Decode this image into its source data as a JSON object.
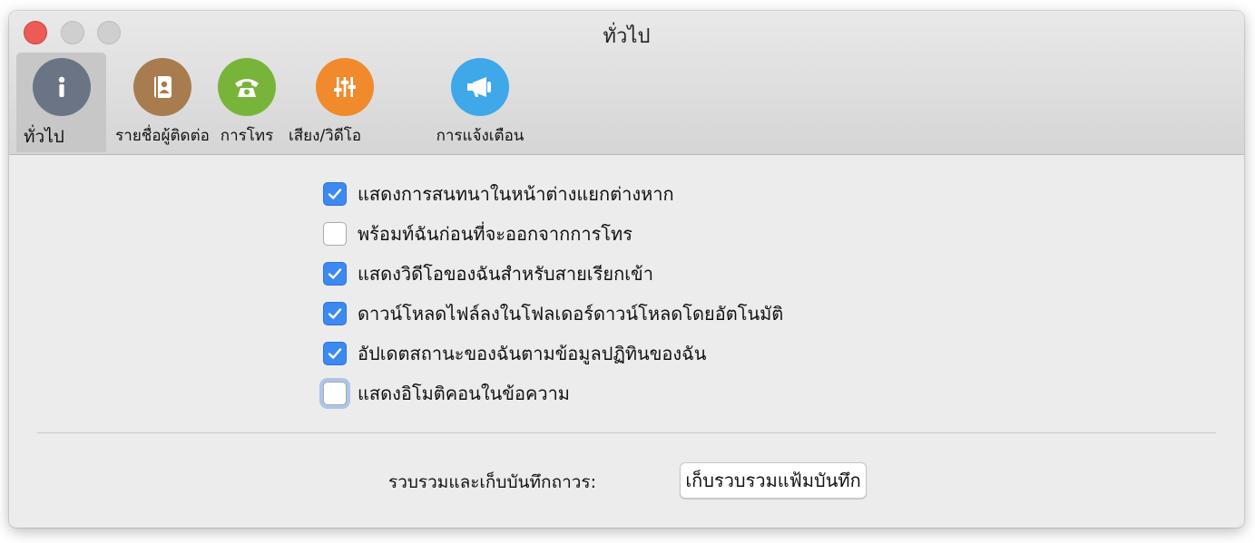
{
  "window": {
    "title": "ทั่วไป"
  },
  "tabs": [
    {
      "label": "ทั่วไป",
      "icon": "info-icon",
      "color": "#6b7485",
      "selected": true
    },
    {
      "label": "รายชื่อผู้ติดต่อ",
      "icon": "contact-book-icon",
      "color": "#a87c4f",
      "selected": false
    },
    {
      "label": "การโทร",
      "icon": "telephone-icon",
      "color": "#79b43a",
      "selected": false
    },
    {
      "label": "เสียง/วิดีโอ",
      "icon": "sliders-icon",
      "color": "#f08a2c",
      "selected": false
    },
    {
      "label": "การแจ้งเตือน",
      "icon": "megaphone-icon",
      "color": "#3ea8e9",
      "selected": false
    }
  ],
  "options": [
    {
      "label": "แสดงการสนทนาในหน้าต่างแยกต่างหาก",
      "checked": true
    },
    {
      "label": "พร้อมท์ฉันก่อนที่จะออกจากการโทร",
      "checked": false
    },
    {
      "label": "แสดงวิดีโอของฉันสำหรับสายเรียกเข้า",
      "checked": true
    },
    {
      "label": "ดาวน์โหลดไฟล์ลงในโฟลเดอร์ดาวน์โหลดโดยอัตโนมัติ",
      "checked": true
    },
    {
      "label": "อัปเดตสถานะของฉันตามข้อมูลปฏิทินของฉัน",
      "checked": true
    },
    {
      "label": "แสดงอิโมติคอนในข้อความ",
      "checked": false,
      "focused": true
    }
  ],
  "archive": {
    "label": "รวบรวมและเก็บบันทึกถาวร:",
    "button_label": "เก็บรวบรวมแฟ้มบันทึก"
  }
}
